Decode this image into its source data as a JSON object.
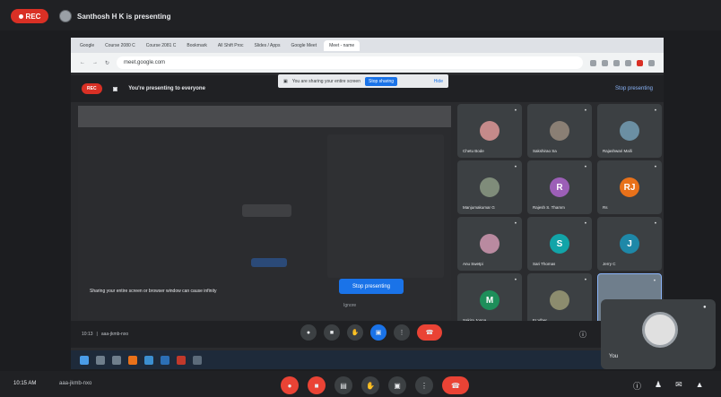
{
  "top": {
    "rec_label": "REC",
    "presenter_text": "Santhosh H K is presenting"
  },
  "shared_screen": {
    "browser": {
      "tabs": [
        "Google",
        "Course 2080 C",
        "Course 2081 C",
        "Bookmark",
        "All Shift Proc",
        "Slides / Apps",
        "Google Meet",
        "Meet - name"
      ],
      "url": "meet.google.com"
    },
    "share_bar": {
      "text": "You are sharing your entire screen",
      "stop_label": "Stop sharing",
      "hide_label": "Hide"
    },
    "inner_meet": {
      "rec_label": "REC",
      "presenting_text": "You're presenting to everyone",
      "stop_presenting_link": "Stop presenting",
      "notice": "Sharing your entire screen or browser window can cause infinity",
      "stop_button": "Stop presenting",
      "ignore_text": "Ignore",
      "footer_time": "10:13",
      "footer_code": "aaa-jkmb-nxo"
    },
    "tiles": [
      {
        "name": "Chetu Bode",
        "initial": "",
        "color": "#c58a8a"
      },
      {
        "name": "Sakshirao Sa",
        "initial": "",
        "color": "#8a7f74"
      },
      {
        "name": "Rajashwari Malli",
        "initial": "",
        "color": "#6b8fa3"
      },
      {
        "name": "Manjumakumar G",
        "initial": "",
        "color": "#7f8c7a"
      },
      {
        "name": "Rajesh S. Thamm",
        "initial": "R",
        "color": "#9c5fb7"
      },
      {
        "name": "Rs",
        "initial": "RJ",
        "color": "#e8711a"
      },
      {
        "name": "Anu Swetpi",
        "initial": "",
        "color": "#b98aa0"
      },
      {
        "name": "Sari Thomas",
        "initial": "S",
        "color": "#12a4a8"
      },
      {
        "name": "Jerry C",
        "initial": "J",
        "color": "#1e88a8"
      },
      {
        "name": "Sakira Jonna",
        "initial": "M",
        "color": "#1e8e5a"
      },
      {
        "name": "Fr Viber",
        "initial": "",
        "color": "#8c8c6e"
      },
      {
        "name": "",
        "initial": "",
        "color": "#6f7e8c"
      }
    ]
  },
  "self_view": {
    "name": "You"
  },
  "bottom": {
    "time": "10:15 AM",
    "meeting_code": "aaa-jkmb-nxo"
  }
}
